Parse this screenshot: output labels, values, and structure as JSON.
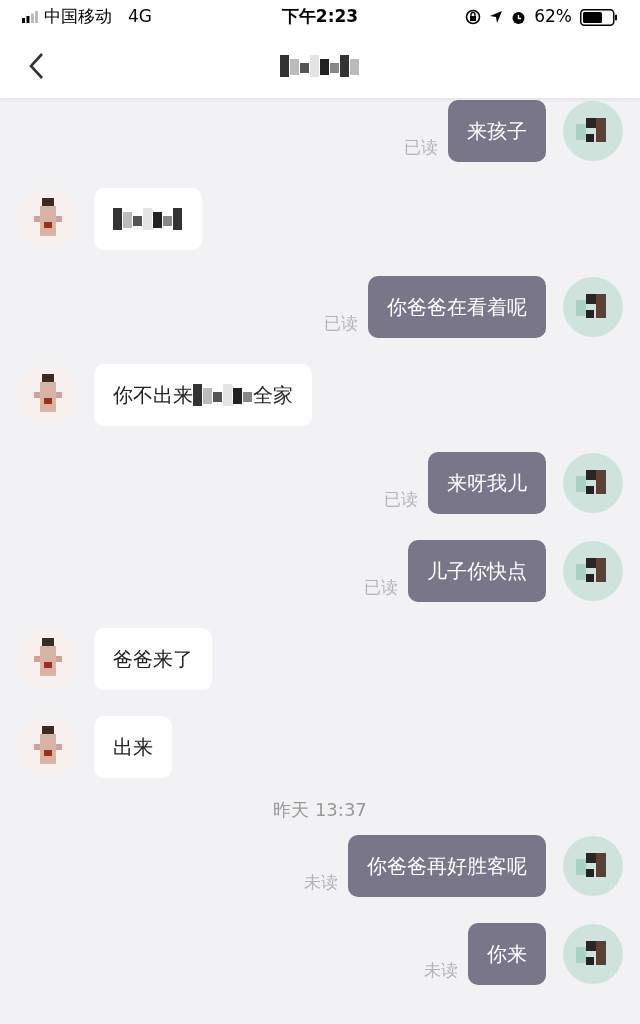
{
  "status_bar": {
    "carrier": "中国移动",
    "network": "4G",
    "time": "下午2:23",
    "battery": "62%"
  },
  "header": {
    "title_redacted": true
  },
  "messages": [
    {
      "kind": "outgoing",
      "receipt": "已读",
      "parts": [
        {
          "kind": "text",
          "text": "来孩子"
        }
      ]
    },
    {
      "kind": "incoming",
      "parts": [
        {
          "kind": "redacted"
        }
      ]
    },
    {
      "kind": "outgoing",
      "receipt": "已读",
      "parts": [
        {
          "kind": "text",
          "text": "你爸爸在看着呢"
        }
      ]
    },
    {
      "kind": "incoming",
      "parts": [
        {
          "kind": "text",
          "text": "你不出来"
        },
        {
          "kind": "redacted"
        },
        {
          "kind": "text",
          "text": "全家"
        }
      ]
    },
    {
      "kind": "outgoing",
      "receipt": "已读",
      "parts": [
        {
          "kind": "text",
          "text": "来呀我儿"
        }
      ]
    },
    {
      "kind": "outgoing",
      "receipt": "已读",
      "parts": [
        {
          "kind": "text",
          "text": "儿子你快点"
        }
      ]
    },
    {
      "kind": "incoming",
      "parts": [
        {
          "kind": "text",
          "text": "爸爸来了"
        }
      ]
    },
    {
      "kind": "incoming",
      "parts": [
        {
          "kind": "text",
          "text": "出来"
        }
      ]
    },
    {
      "kind": "time",
      "text": "昨天 13:37"
    },
    {
      "kind": "outgoing",
      "receipt": "未读",
      "parts": [
        {
          "kind": "text",
          "text": "你爸爸再好胜客呢"
        }
      ]
    },
    {
      "kind": "outgoing",
      "receipt": "未读",
      "parts": [
        {
          "kind": "text",
          "text": "你来"
        }
      ]
    }
  ]
}
